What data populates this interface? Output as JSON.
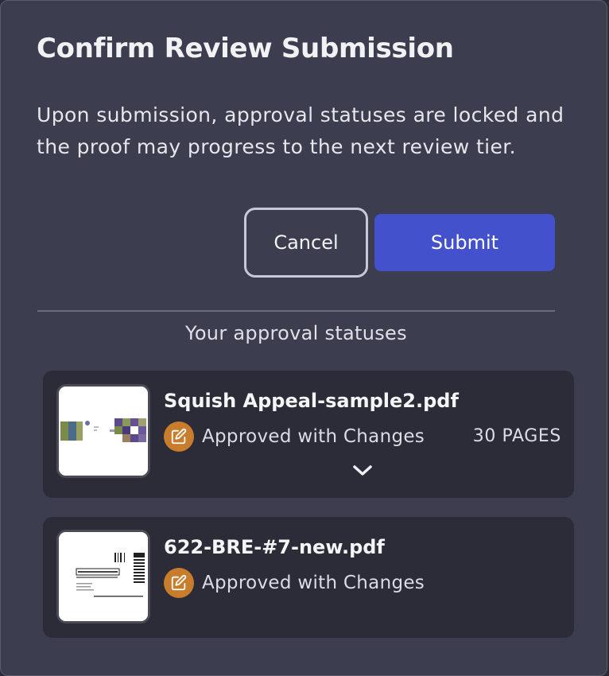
{
  "dialog": {
    "title": "Confirm Review Submission",
    "description": "Upon submission, approval statuses are locked and the proof may progress to the next review tier.",
    "cancel_label": "Cancel",
    "submit_label": "Submit"
  },
  "statuses": {
    "heading": "Your approval statuses",
    "items": [
      {
        "file_name": "Squish Appeal-sample2.pdf",
        "status": "Approved with Changes",
        "status_icon": "edit-pencil-icon",
        "pages": "30 PAGES",
        "expand_icon": "chevron-down-icon"
      },
      {
        "file_name": "622-BRE-#7-new.pdf",
        "status": "Approved with Changes",
        "status_icon": "edit-pencil-icon"
      }
    ]
  },
  "colors": {
    "modal_bg": "#3c3d4e",
    "card_bg": "#2b2c37",
    "accent": "#4351cc",
    "status_orange": "#c87d2c"
  }
}
